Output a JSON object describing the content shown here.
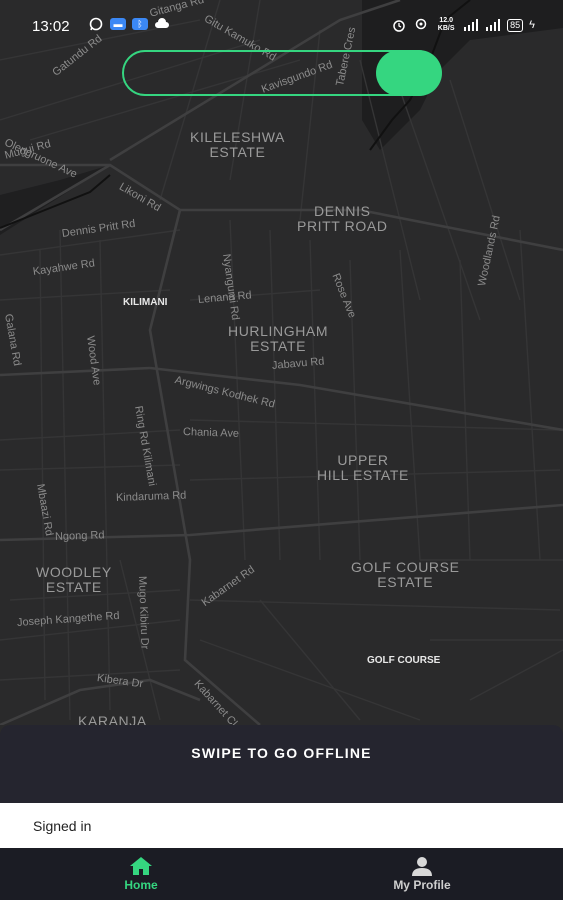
{
  "status_bar": {
    "time": "13:02",
    "speed": "12.0 KB/S",
    "battery": "85"
  },
  "map": {
    "area_labels": [
      {
        "id": "kileleshwa",
        "text": "KILELESHWA\nESTATE"
      },
      {
        "id": "dennis",
        "text": "DENNIS\nPRITT ROAD"
      },
      {
        "id": "hurlingham",
        "text": "HURLINGHAM\nESTATE"
      },
      {
        "id": "upperhill",
        "text": "UPPER\nHILL ESTATE"
      },
      {
        "id": "woodley",
        "text": "WOODLEY\nESTATE"
      },
      {
        "id": "golfcourse",
        "text": "GOLF COURSE\nESTATE"
      },
      {
        "id": "karanja",
        "text": "KARANJA"
      }
    ],
    "poi_labels": {
      "kilimani": "KILIMANI",
      "golf_course": "GOLF COURSE"
    },
    "road_labels": {
      "gatundu": "Gatundu Rd",
      "gitanga": "Gitanga Rd",
      "gitekamuko": "Gitu Kamuko Rd",
      "kavisgundo": "Kavisgundo Rd",
      "tabere": "Tabere Cres",
      "olengruone": "Olengruone Ave",
      "mugui": "Mugui Rd",
      "likoni": "Likoni Rd",
      "dennis_pritt": "Dennis Pritt Rd",
      "nyangumi": "Nyangumi Rd",
      "rose": "Rose Ave",
      "woodlands": "Woodlands Rd",
      "kayahwe": "Kayahwe Rd",
      "lenana": "Lenana Rd",
      "galana": "Galana Rd",
      "wood": "Wood Ave",
      "jabavu": "Jabavu Rd",
      "argwings": "Argwings Kodhek Rd",
      "ring_kilimani": "Ring Rd Kilimani",
      "chania": "Chania Ave",
      "kindaruma": "Kindaruma Rd",
      "mbaazi": "Mbaazi Rd",
      "ngong": "Ngong Rd",
      "mugo_kibiru": "Mugo Kibiru Dr",
      "kabarnet_rd": "Kabarnet Rd",
      "joseph_kangethe": "Joseph Kangethe Rd",
      "kibera": "Kibera Dr",
      "kabarnet_cl": "Kabarnet Cl"
    }
  },
  "offline_panel": {
    "title": "SWIPE TO GO OFFLINE"
  },
  "status_strip": {
    "text": "Signed in"
  },
  "bottom_nav": {
    "home_label": "Home",
    "profile_label": "My Profile"
  },
  "colors": {
    "accent": "#35d680",
    "map_bg": "#2a2a2b",
    "panel_bg": "#25252f"
  }
}
